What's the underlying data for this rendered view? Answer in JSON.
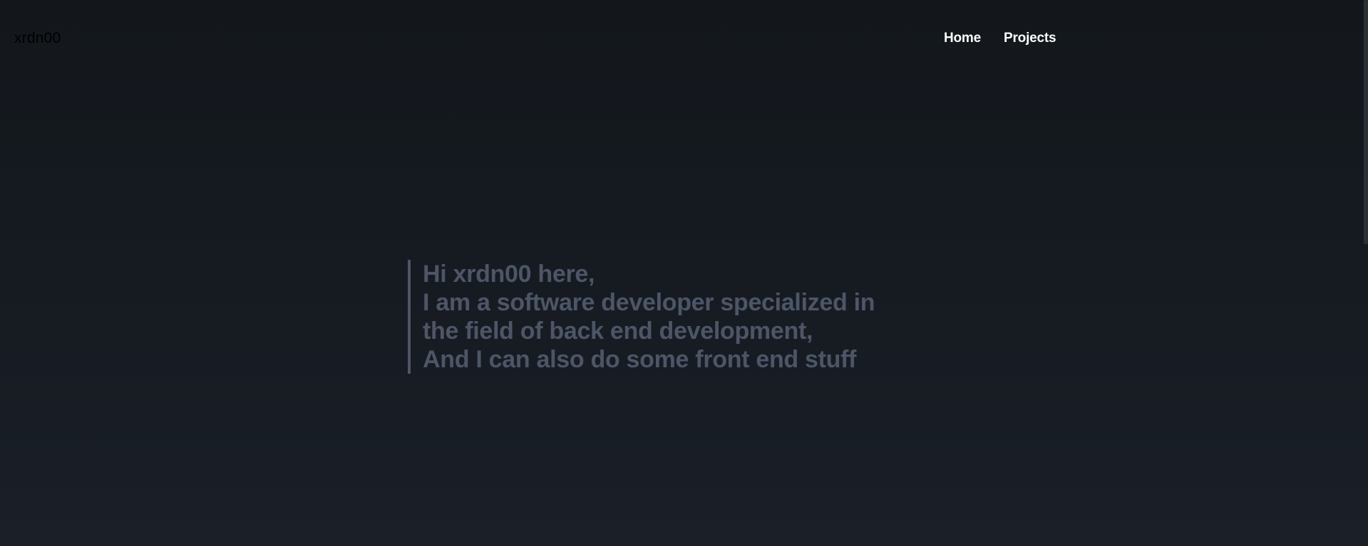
{
  "header": {
    "logo": "xrdn00",
    "nav": {
      "home": "Home",
      "projects": "Projects"
    }
  },
  "hero": {
    "lines": [
      "Hi xrdn00 here,",
      "I am a software developer specialized in",
      "the field of back end development,",
      "And I can also do some front end stuff"
    ]
  },
  "colors": {
    "background": "#13171c",
    "hero_text": "#4d5566",
    "nav_text": "#ffffff",
    "logo_text": "#000000"
  }
}
